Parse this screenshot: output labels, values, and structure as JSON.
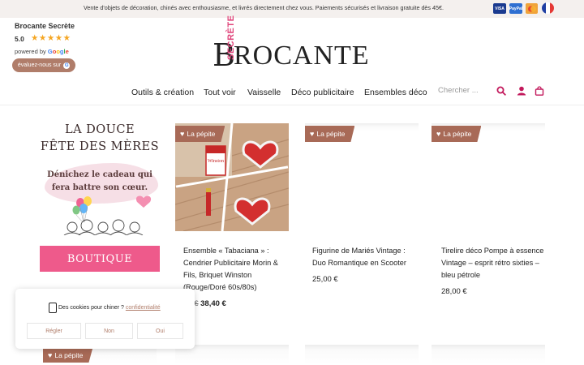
{
  "topbar": {
    "message": "Vente d'objets de décoration, chinés avec enthousiasme, et livrés directement chez vous. Paiements sécurisés et livraison gratuite dès 45€.",
    "payments": [
      "VISA",
      "PayPal",
      "Mastercard"
    ],
    "flag": "french-flag"
  },
  "review": {
    "business": "Brocante Secrète",
    "score": "5.0",
    "stars": "★★★★★",
    "powered_by": "powered by",
    "google": [
      "G",
      "o",
      "o",
      "g",
      "l",
      "e"
    ],
    "button": "évaluez-nous sur",
    "google_g": "G"
  },
  "logo": {
    "initial": "B",
    "word": "ROCANTE",
    "secrete": "SECRÈTE"
  },
  "nav": {
    "items": [
      "Outils & création",
      "Tout voir",
      "Vaisselle",
      "Déco publicitaire",
      "Ensembles déco"
    ],
    "search_placeholder": "Chercher ..."
  },
  "promo": {
    "title_line1": "LA DOUCE",
    "title_line2": "FÊTE DES MÈRES",
    "subtitle_line1": "Dénichez le cadeau qui",
    "subtitle_line2": "fera battre son cœur.",
    "button": "BOUTIQUE"
  },
  "badge_label": "La pépite",
  "products": [
    {
      "title_lines": [
        "Ensemble « Tabaciana » :",
        "Cendrier Publicitaire Morin &",
        "Fils, Briquet Winston",
        "(Rouge/Doré 60s/80s)"
      ],
      "old_price": "00 €",
      "price": "38,40 €"
    },
    {
      "title_lines": [
        "Figurine de Mariés Vintage :",
        "Duo Romantique en Scooter"
      ],
      "price": "25,00 €"
    },
    {
      "title_lines": [
        "Tirelire déco Pompe à essence",
        "Vintage – esprit rétro sixties –",
        "bleu pétrole"
      ],
      "price": "28,00 €"
    }
  ],
  "product_image_text": "Winston",
  "cookie": {
    "text": "Des cookies pour chiner ?",
    "link": "confidentialité",
    "buttons": [
      "Régler",
      "Non",
      "Oui"
    ]
  },
  "colors": {
    "accent": "#e0457b",
    "brown": "#b07d6a",
    "badge": "#a86a57",
    "promo_button": "#ee5a8b"
  }
}
